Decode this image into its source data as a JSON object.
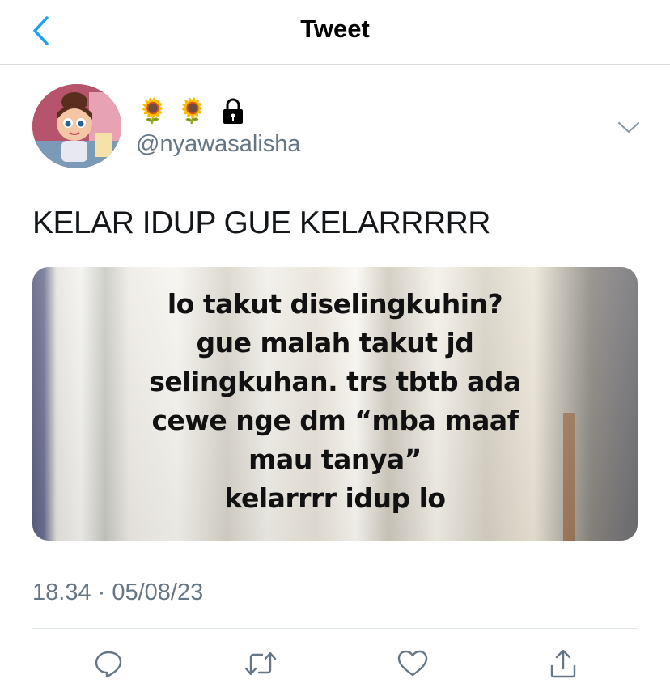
{
  "navbar": {
    "title": "Tweet"
  },
  "author": {
    "badges": [
      "🌻",
      "🌻"
    ],
    "handle": "@nyawasalisha",
    "protected": true
  },
  "tweet": {
    "text": "KELAR IDUP GUE KELARRRRR",
    "media_text": [
      "lo takut diselingkuhin?",
      "gue malah takut jd",
      "selingkuhan. trs tbtb ada",
      "cewe nge dm “mba maaf",
      "mau tanya”",
      "kelarrrr idup lo"
    ],
    "timestamp": "18.34 · 05/08/23"
  },
  "actions": [
    "reply-icon",
    "retweet-icon",
    "like-icon",
    "share-icon"
  ],
  "colors": {
    "accent": "#1da1f2",
    "secondary_text": "#657786",
    "icon": "#657786"
  }
}
